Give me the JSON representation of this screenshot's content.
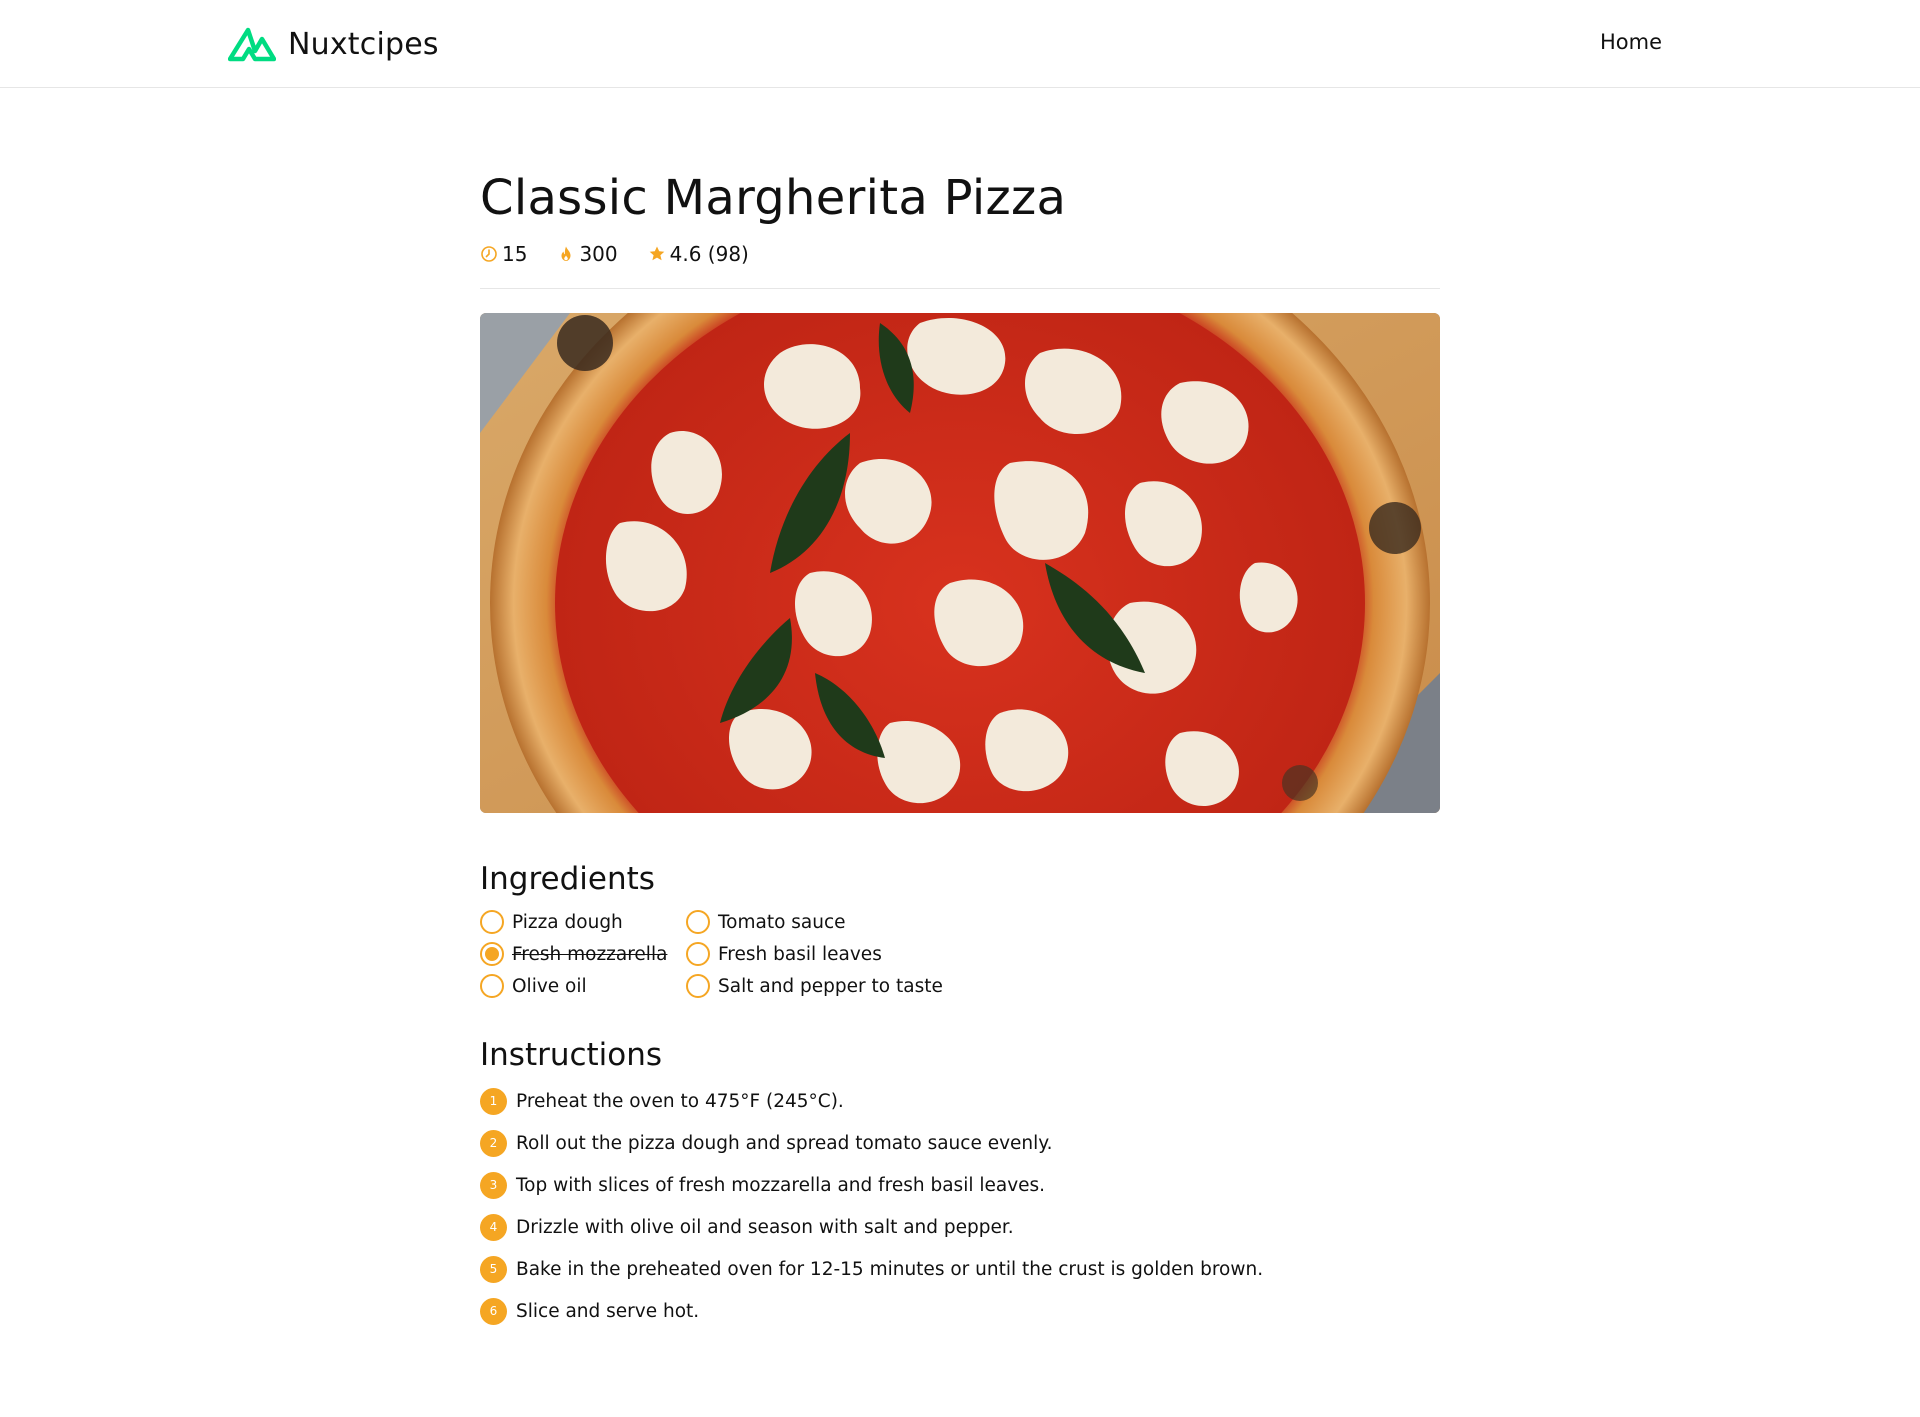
{
  "app": {
    "name": "Nuxtcipes",
    "logo_icon": "nuxt-logo-icon",
    "accent_color": "#00DC82"
  },
  "nav": {
    "home_label": "Home"
  },
  "recipe": {
    "title": "Classic Margherita Pizza",
    "meta": {
      "time": "15",
      "time_icon": "clock-icon",
      "calories": "300",
      "calories_icon": "flame-icon",
      "rating": "4.6 (98)",
      "rating_icon": "star-icon",
      "icon_color": "#F5A623"
    },
    "image_alt": "Classic Margherita Pizza",
    "ingredients_title": "Ingredients",
    "ingredients": [
      {
        "label": "Pizza dough",
        "checked": false
      },
      {
        "label": "Tomato sauce",
        "checked": false
      },
      {
        "label": "Fresh mozzarella",
        "checked": true
      },
      {
        "label": "Fresh basil leaves",
        "checked": false
      },
      {
        "label": "Olive oil",
        "checked": false
      },
      {
        "label": "Salt and pepper to taste",
        "checked": false
      }
    ],
    "instructions_title": "Instructions",
    "instructions": [
      {
        "num": "1",
        "text": "Preheat the oven to 475°F (245°C)."
      },
      {
        "num": "2",
        "text": "Roll out the pizza dough and spread tomato sauce evenly."
      },
      {
        "num": "3",
        "text": "Top with slices of fresh mozzarella and fresh basil leaves."
      },
      {
        "num": "4",
        "text": "Drizzle with olive oil and season with salt and pepper."
      },
      {
        "num": "5",
        "text": "Bake in the preheated oven for 12-15 minutes or until the crust is golden brown."
      },
      {
        "num": "6",
        "text": "Slice and serve hot."
      }
    ]
  }
}
